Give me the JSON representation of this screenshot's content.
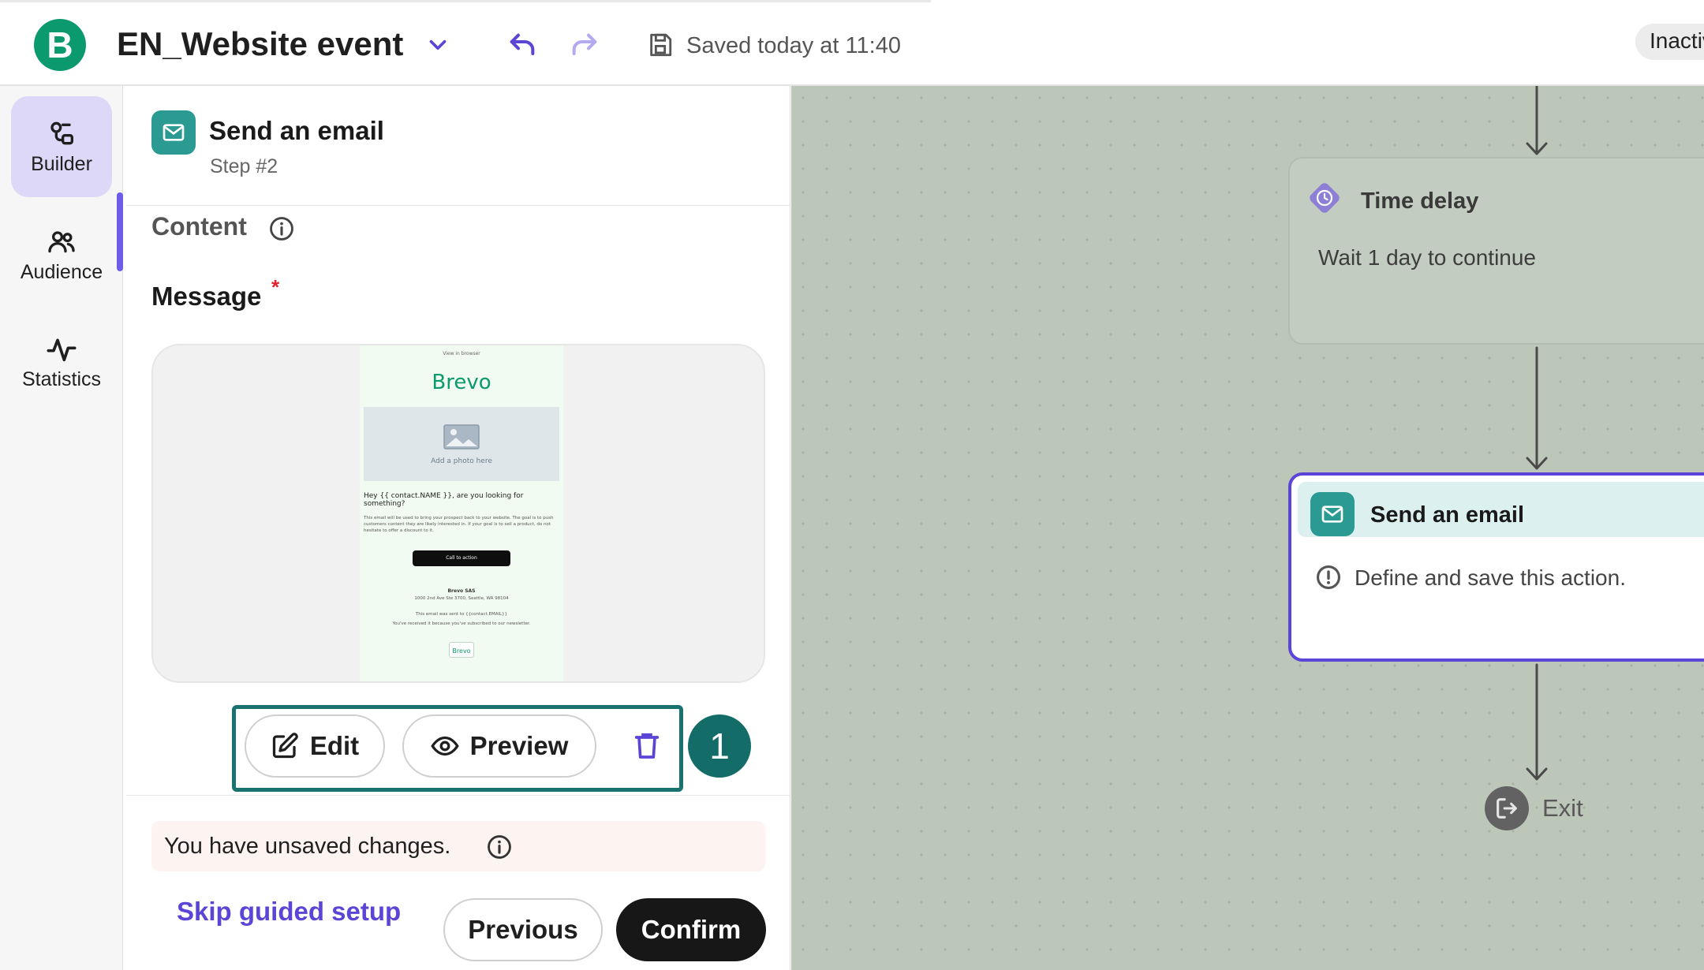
{
  "colors": {
    "brand_green": "#0b996e",
    "accent_purple": "#5b45d6",
    "teal_icon": "#2a9a93",
    "highlight_teal": "#1a7270",
    "canvas_bg": "#bcc6b9"
  },
  "header": {
    "logo_letter": "B",
    "title": "EN_Website event",
    "save_status": "Saved today at 11:40",
    "status_badge": "Inactive"
  },
  "sidebar": {
    "items": [
      {
        "label": "Builder",
        "icon": "builder-icon",
        "active": true
      },
      {
        "label": "Audience",
        "icon": "audience-icon",
        "active": false
      },
      {
        "label": "Statistics",
        "icon": "statistics-icon",
        "active": false
      }
    ]
  },
  "panel": {
    "title": "Send an email",
    "step": "Step #2",
    "content_label": "Content",
    "message_label": "Message",
    "required_mark": "*",
    "email_preview": {
      "view_online": "View in browser",
      "brand": "Brevo",
      "photo_caption": "Add a photo here",
      "greeting": "Hey {{ contact.NAME }}, are you looking for something?",
      "body": "This email will be used to bring your prospect back to your website. The goal is to push customers content they are likely interested in. If your goal is to sell a product, do not hesitate to offer a discount to it.",
      "cta": "Call to action",
      "company": "Brevo SAS",
      "address": "1000 2nd Ave Ste 3700, Seattle, WA 98104",
      "sent_to": "This email was sent to {{contact.EMAIL}}",
      "reason": "You've received it because you've subscribed to our newsletter.",
      "badge": "Brevo"
    },
    "actions": {
      "edit": "Edit",
      "preview": "Preview",
      "marker": "1"
    },
    "footer": {
      "unsaved": "You have unsaved changes.",
      "skip": "Skip guided setup",
      "previous": "Previous",
      "confirm": "Confirm"
    }
  },
  "canvas": {
    "delay_node": {
      "title": "Time delay",
      "description": "Wait 1 day to continue"
    },
    "email_node": {
      "title": "Send an email",
      "description": "Define and save this action."
    },
    "exit_label": "Exit"
  }
}
